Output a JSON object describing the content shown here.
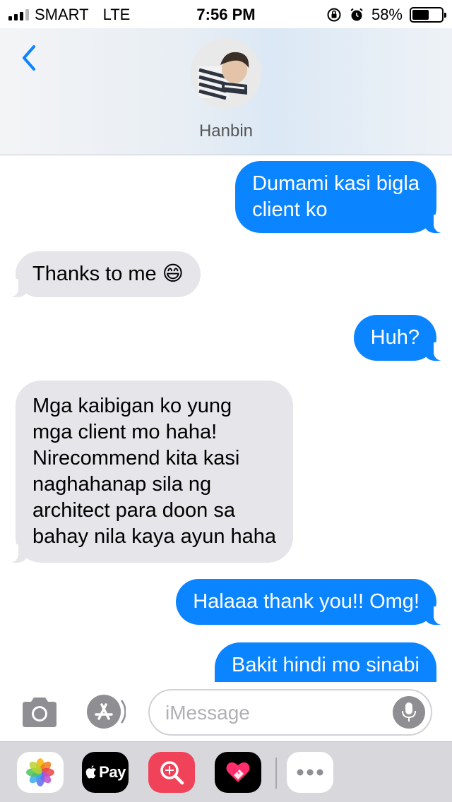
{
  "status_bar": {
    "carrier": "SMART",
    "network": "LTE",
    "time": "7:56 PM",
    "battery_percent": "58%",
    "battery_level": 0.58
  },
  "header": {
    "contact_name": "Hanbin"
  },
  "messages": [
    {
      "direction": "outgoing",
      "lines": [
        "Dumami kasi bigla",
        "client ko"
      ]
    },
    {
      "direction": "incoming",
      "lines": [
        "Thanks to me 😄"
      ]
    },
    {
      "direction": "outgoing",
      "lines": [
        "Huh?"
      ]
    },
    {
      "direction": "incoming",
      "lines": [
        "Mga kaibigan ko yung",
        "mga client mo haha!",
        "Nirecommend kita kasi",
        "naghahanap sila ng",
        "architect para doon sa",
        "bahay nila kaya ayun haha"
      ]
    },
    {
      "direction": "outgoing",
      "lines": [
        "Halaaa thank you!! Omg!"
      ]
    },
    {
      "direction": "outgoing",
      "lines": [
        "Bakit hindi mo sinabi"
      ]
    }
  ],
  "input_bar": {
    "placeholder": "iMessage"
  },
  "app_drawer": {
    "apps": [
      {
        "name": "Photos",
        "icon": "photos-icon"
      },
      {
        "name": "Apple Pay",
        "icon": "apple-pay-icon",
        "label": "Pay"
      },
      {
        "name": "Search Images",
        "icon": "search-images-icon"
      },
      {
        "name": "Digital Touch",
        "icon": "digital-touch-icon"
      },
      {
        "name": "More",
        "icon": "more-icon"
      }
    ]
  },
  "colors": {
    "outgoing_bubble": "#0b84ff",
    "incoming_bubble": "#e5e5ea",
    "accent": "#0b84ff"
  }
}
